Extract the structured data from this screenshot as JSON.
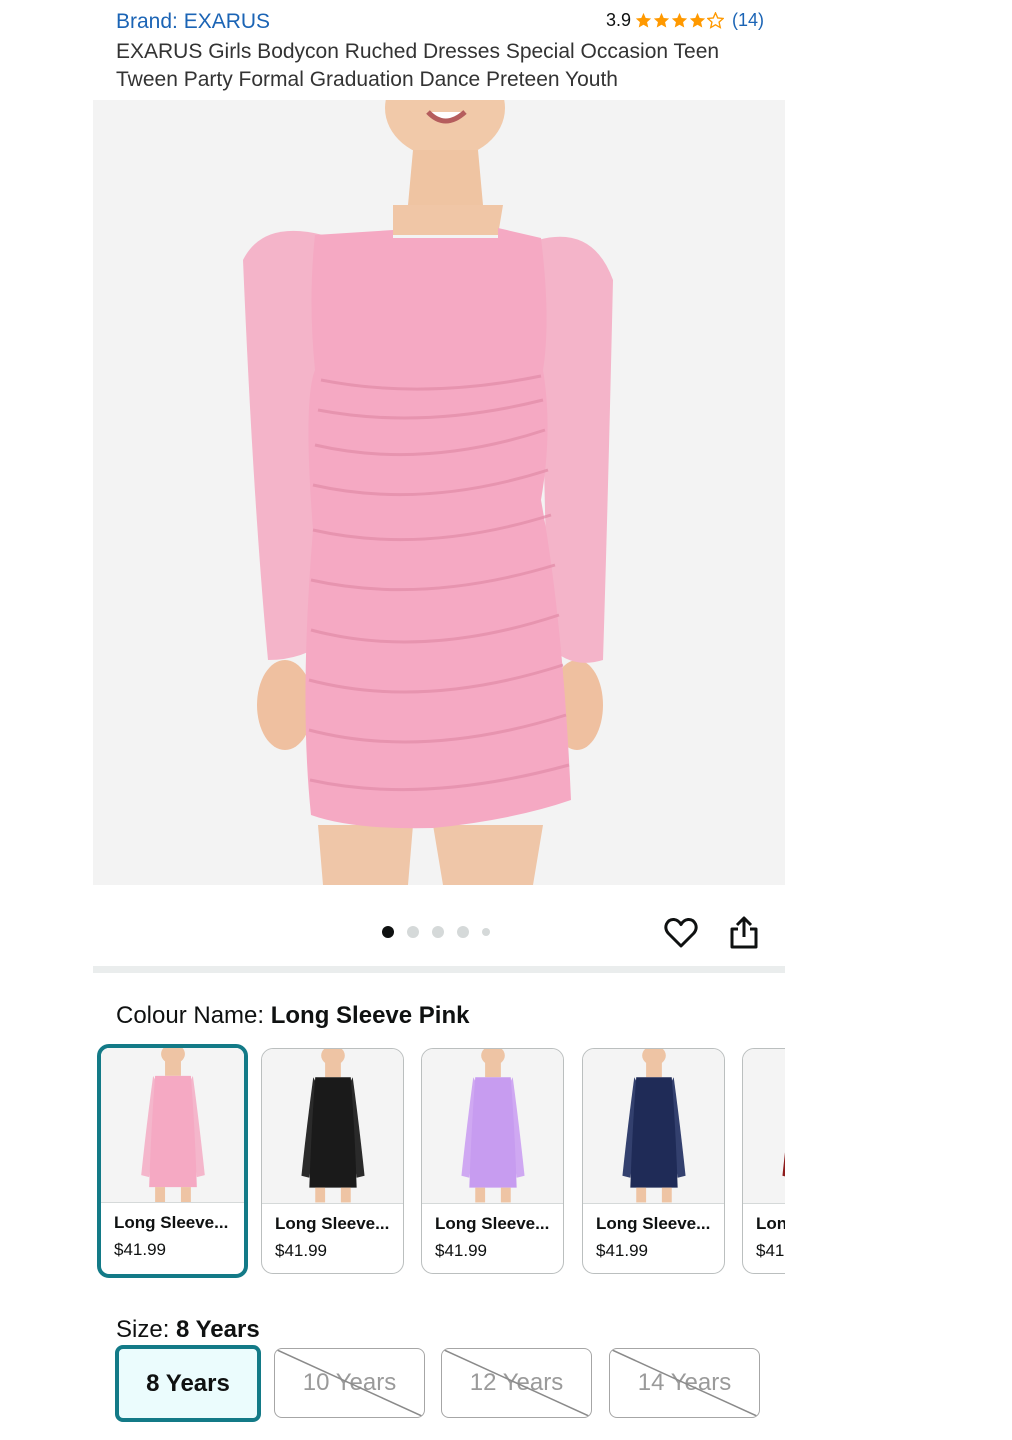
{
  "product": {
    "brand": "Brand: EXARUS",
    "rating": "3.9",
    "review_count": "(14)",
    "stars": [
      "full",
      "full",
      "full",
      "full",
      "empty"
    ],
    "title": "EXARUS Girls Bodycon Ruched Dresses Special Occasion Teen Tween Party Formal Graduation Dance Preteen Youth"
  },
  "gallery": {
    "dots": [
      "active",
      "inactive",
      "inactive",
      "inactive",
      "small"
    ],
    "dress_color": "#f5a9c3"
  },
  "colour": {
    "label": "Colour Name: ",
    "selected": "Long Sleeve Pink",
    "options": [
      {
        "name": "Long Sleeve...",
        "price": "$41.99",
        "color": "#f5a9c3",
        "sleeve": "#f4b6cb"
      },
      {
        "name": "Long Sleeve...",
        "price": "$41.99",
        "color": "#1a1a1a",
        "sleeve": "#2a2a2a"
      },
      {
        "name": "Long Sleeve...",
        "price": "$41.99",
        "color": "#c79cf0",
        "sleeve": "#cfa8f2"
      },
      {
        "name": "Long Sleeve...",
        "price": "$41.99",
        "color": "#1f2b57",
        "sleeve": "#33406e"
      },
      {
        "name": "Lon",
        "price": "$41",
        "color": "#8e1c1c",
        "sleeve": "#8e1c1c"
      }
    ]
  },
  "size": {
    "label": "Size: ",
    "selected": "8 Years",
    "options": [
      {
        "label": "8 Years",
        "available": true
      },
      {
        "label": "10 Years",
        "available": false
      },
      {
        "label": "12 Years",
        "available": false
      },
      {
        "label": "14 Years",
        "available": false
      }
    ]
  },
  "colors": {
    "link": "#1b64b5",
    "star": "#ff9900",
    "selected_border": "#137a87"
  }
}
